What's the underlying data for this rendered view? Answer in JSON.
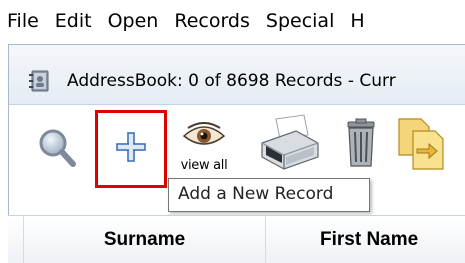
{
  "menubar": {
    "items": [
      {
        "label": "File"
      },
      {
        "label": "Edit"
      },
      {
        "label": "Open"
      },
      {
        "label": "Records"
      },
      {
        "label": "Special"
      },
      {
        "label": "H"
      }
    ]
  },
  "window": {
    "title": "AddressBook: 0 of 8698 Records - Curr",
    "icon": "addressbook-app-icon"
  },
  "toolbar": {
    "search_icon": "magnifier-icon",
    "add_icon": "plus-icon",
    "view_label": "view all",
    "view_icon": "eye-icon",
    "print_icon": "printer-icon",
    "trash_icon": "trash-icon",
    "docs_icon": "documents-icon",
    "add_highlight_color": "#e00000"
  },
  "tooltip": {
    "text": "Add a New Record"
  },
  "table": {
    "columns": [
      {
        "label": "Surname"
      },
      {
        "label": "First Name"
      }
    ]
  }
}
